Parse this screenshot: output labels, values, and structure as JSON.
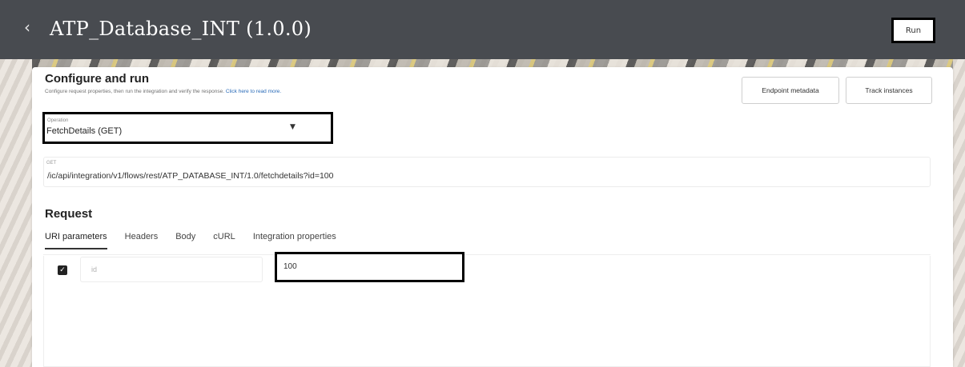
{
  "header": {
    "title": "ATP_Database_INT (1.0.0)",
    "back_icon": "chevron-left-icon",
    "run_label": "Run"
  },
  "card": {
    "title": "Configure and run",
    "subtitle": "Configure request properties, then run the integration and verify the response.",
    "subtitle_link": "Click here to read more.",
    "endpoint_metadata_label": "Endpoint metadata",
    "track_instances_label": "Track instances"
  },
  "operation": {
    "label": "Operation",
    "value": "FetchDetails (GET)"
  },
  "url": {
    "method": "GET",
    "value": "/ic/api/integration/v1/flows/rest/ATP_DATABASE_INT/1.0/fetchdetails?id=100"
  },
  "request": {
    "heading": "Request",
    "tabs": [
      {
        "label": "URI parameters",
        "active": true
      },
      {
        "label": "Headers",
        "active": false
      },
      {
        "label": "Body",
        "active": false
      },
      {
        "label": "cURL",
        "active": false
      },
      {
        "label": "Integration properties",
        "active": false
      }
    ],
    "params": [
      {
        "checked": true,
        "name": "id",
        "value": "100"
      }
    ]
  },
  "colors": {
    "header_bg": "#484b50",
    "card_bg": "#ffffff",
    "link": "#2a6bb8"
  }
}
